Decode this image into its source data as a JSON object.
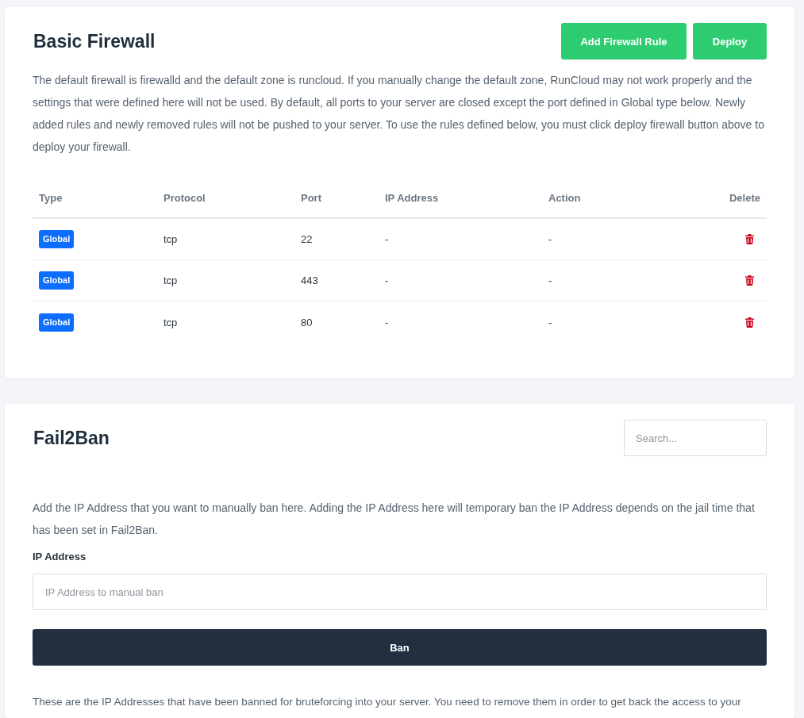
{
  "firewall": {
    "title": "Basic Firewall",
    "buttons": [
      {
        "label": "Add Firewall Rule"
      },
      {
        "label": "Deploy"
      }
    ],
    "description": "The default firewall is firewalld and the default zone is runcloud. If you manually change the default zone, RunCloud may not work properly and the settings that were defined here will not be used. By default, all ports to your server are closed except the port defined in Global type below. Newly added rules and newly removed rules will not be pushed to your server. To use the rules defined below, you must click deploy firewall button above to deploy your firewall.",
    "table": {
      "columns": [
        "Type",
        "Protocol",
        "Port",
        "IP Address",
        "Action",
        "Delete"
      ],
      "rows": [
        {
          "type": "Global",
          "protocol": "tcp",
          "port": "22",
          "ip_address": "-",
          "action": "-"
        },
        {
          "type": "Global",
          "protocol": "tcp",
          "port": "443",
          "ip_address": "-",
          "action": "-"
        },
        {
          "type": "Global",
          "protocol": "tcp",
          "port": "80",
          "ip_address": "-",
          "action": "-"
        }
      ]
    }
  },
  "fail2ban": {
    "title": "Fail2Ban",
    "search": {
      "placeholder": "Search..."
    },
    "description": "Add the IP Address that you want to manually ban here. Adding the IP Address here will temporary ban the IP Address depends on the jail time that has been set in Fail2Ban.",
    "ip_field": {
      "label": "IP Address",
      "placeholder": "IP Address to manual ban"
    },
    "ban_button": "Ban",
    "banned_note": "These are the IP Addresses that have been banned for bruteforcing into your server. You need to remove them in order to get back the access to your"
  }
}
